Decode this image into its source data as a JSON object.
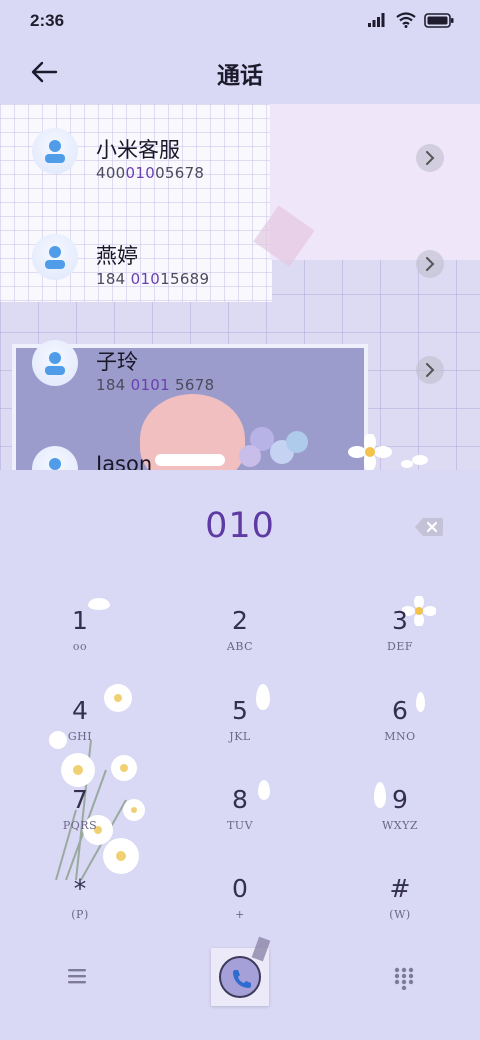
{
  "status": {
    "time": "2:36"
  },
  "header": {
    "title": "通话"
  },
  "contacts": [
    {
      "name": "小米客服",
      "num_pre": "400",
      "num_hl": "010",
      "num_post": "05678"
    },
    {
      "name": "燕婷",
      "num_pre": "184 ",
      "num_hl": "010",
      "num_post": "15689"
    },
    {
      "name": "子玲",
      "num_pre": "184 ",
      "num_hl": "0101",
      "num_post": " 5678"
    },
    {
      "name": "Jason",
      "num_pre": "",
      "num_hl": "",
      "num_post": ""
    }
  ],
  "dialpad": {
    "entered": "010",
    "keys": [
      {
        "digit": "1",
        "letters": "oo"
      },
      {
        "digit": "2",
        "letters": "ABC"
      },
      {
        "digit": "3",
        "letters": "DEF"
      },
      {
        "digit": "4",
        "letters": "GHI"
      },
      {
        "digit": "5",
        "letters": "JKL"
      },
      {
        "digit": "6",
        "letters": "MNO"
      },
      {
        "digit": "7",
        "letters": "PQRS"
      },
      {
        "digit": "8",
        "letters": "TUV"
      },
      {
        "digit": "9",
        "letters": "WXYZ"
      },
      {
        "digit": "*",
        "letters": "(P)"
      },
      {
        "digit": "0",
        "letters": "+"
      },
      {
        "digit": "#",
        "letters": "(W)"
      }
    ]
  },
  "colors": {
    "accent": "#6a3fb0",
    "background": "#d9d8f5"
  },
  "icons": [
    "signal-icon",
    "wifi-icon",
    "battery-icon",
    "back-arrow-icon",
    "chevron-right-icon",
    "backspace-icon",
    "menu-icon",
    "phone-icon",
    "keypad-icon"
  ]
}
